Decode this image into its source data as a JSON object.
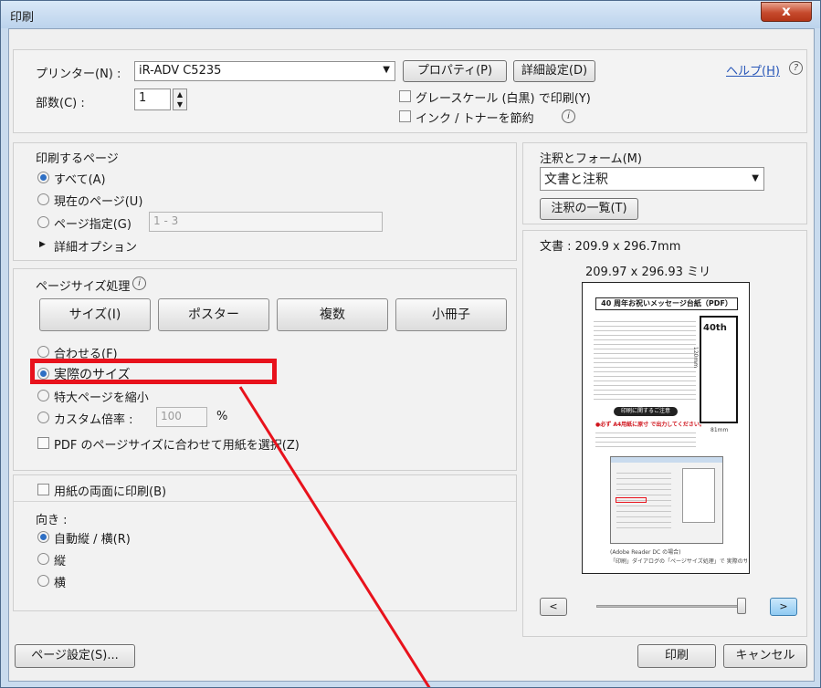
{
  "window": {
    "title": "印刷",
    "close_label": "x"
  },
  "printer": {
    "label": "プリンター(N) :",
    "value": "iR-ADV C5235",
    "properties_label": "プロパティ(P)",
    "advanced_label": "詳細設定(D)",
    "help_label": "ヘルプ(H)",
    "help_icon": "?"
  },
  "copies": {
    "label": "部数(C) :",
    "value": "1"
  },
  "options": {
    "grayscale_label": "グレースケール (白黒) で印刷(Y)",
    "save_ink_label": "インク / トナーを節約",
    "info_icon": "i"
  },
  "pages": {
    "title": "印刷するページ",
    "all_label": "すべて(A)",
    "current_label": "現在のページ(U)",
    "range_label": "ページ指定(G)",
    "range_value": "1 - 3",
    "more_options_label": "詳細オプション",
    "expand_icon": "▶"
  },
  "sizing": {
    "title": "ページサイズ処理",
    "info_icon": "i",
    "tabs": [
      "サイズ(I)",
      "ポスター",
      "複数",
      "小冊子"
    ],
    "fit_label": "合わせる(F)",
    "actual_label": "実際のサイズ",
    "shrink_label": "特大ページを縮小",
    "custom_label": "カスタム倍率 :",
    "custom_value": "100",
    "percent": "%",
    "choose_paper_label": "PDF のページサイズに合わせて用紙を選択(Z)"
  },
  "duplex": {
    "label": "用紙の両面に印刷(B)"
  },
  "orientation": {
    "title": "向き :",
    "auto_label": "自動縦 / 横(R)",
    "portrait_label": "縦",
    "landscape_label": "横"
  },
  "comments": {
    "title": "注釈とフォーム(M)",
    "value": "文書と注釈",
    "summarize_label": "注釈の一覧(T)"
  },
  "preview": {
    "doc_size_label": "文書 : 209.9 x 296.7mm",
    "page_size": "209.97 x 296.93 ミリ",
    "prev_label": "<",
    "next_label": ">",
    "slider_value": 0.97,
    "doc": {
      "title": "40 周年お祝いメッセージ台紙（PDF）",
      "big_label": "40th",
      "measure_label": "81mm",
      "side_label": "120mm",
      "notice_label": "印刷に関するご注意",
      "notice_line": "●必ず A4用紙に原寸 で出力してください。",
      "caption_line1": "(Adobe Reader DC の場合)",
      "caption_line2": "「印刷」ダイアログの「ページサイズ処理」で 実際のサイズ を選択します。"
    }
  },
  "footer": {
    "page_setup_label": "ページ設定(S)...",
    "print_label": "印刷",
    "cancel_label": "キャンセル"
  },
  "annotation": {
    "color": "#e8121c"
  }
}
